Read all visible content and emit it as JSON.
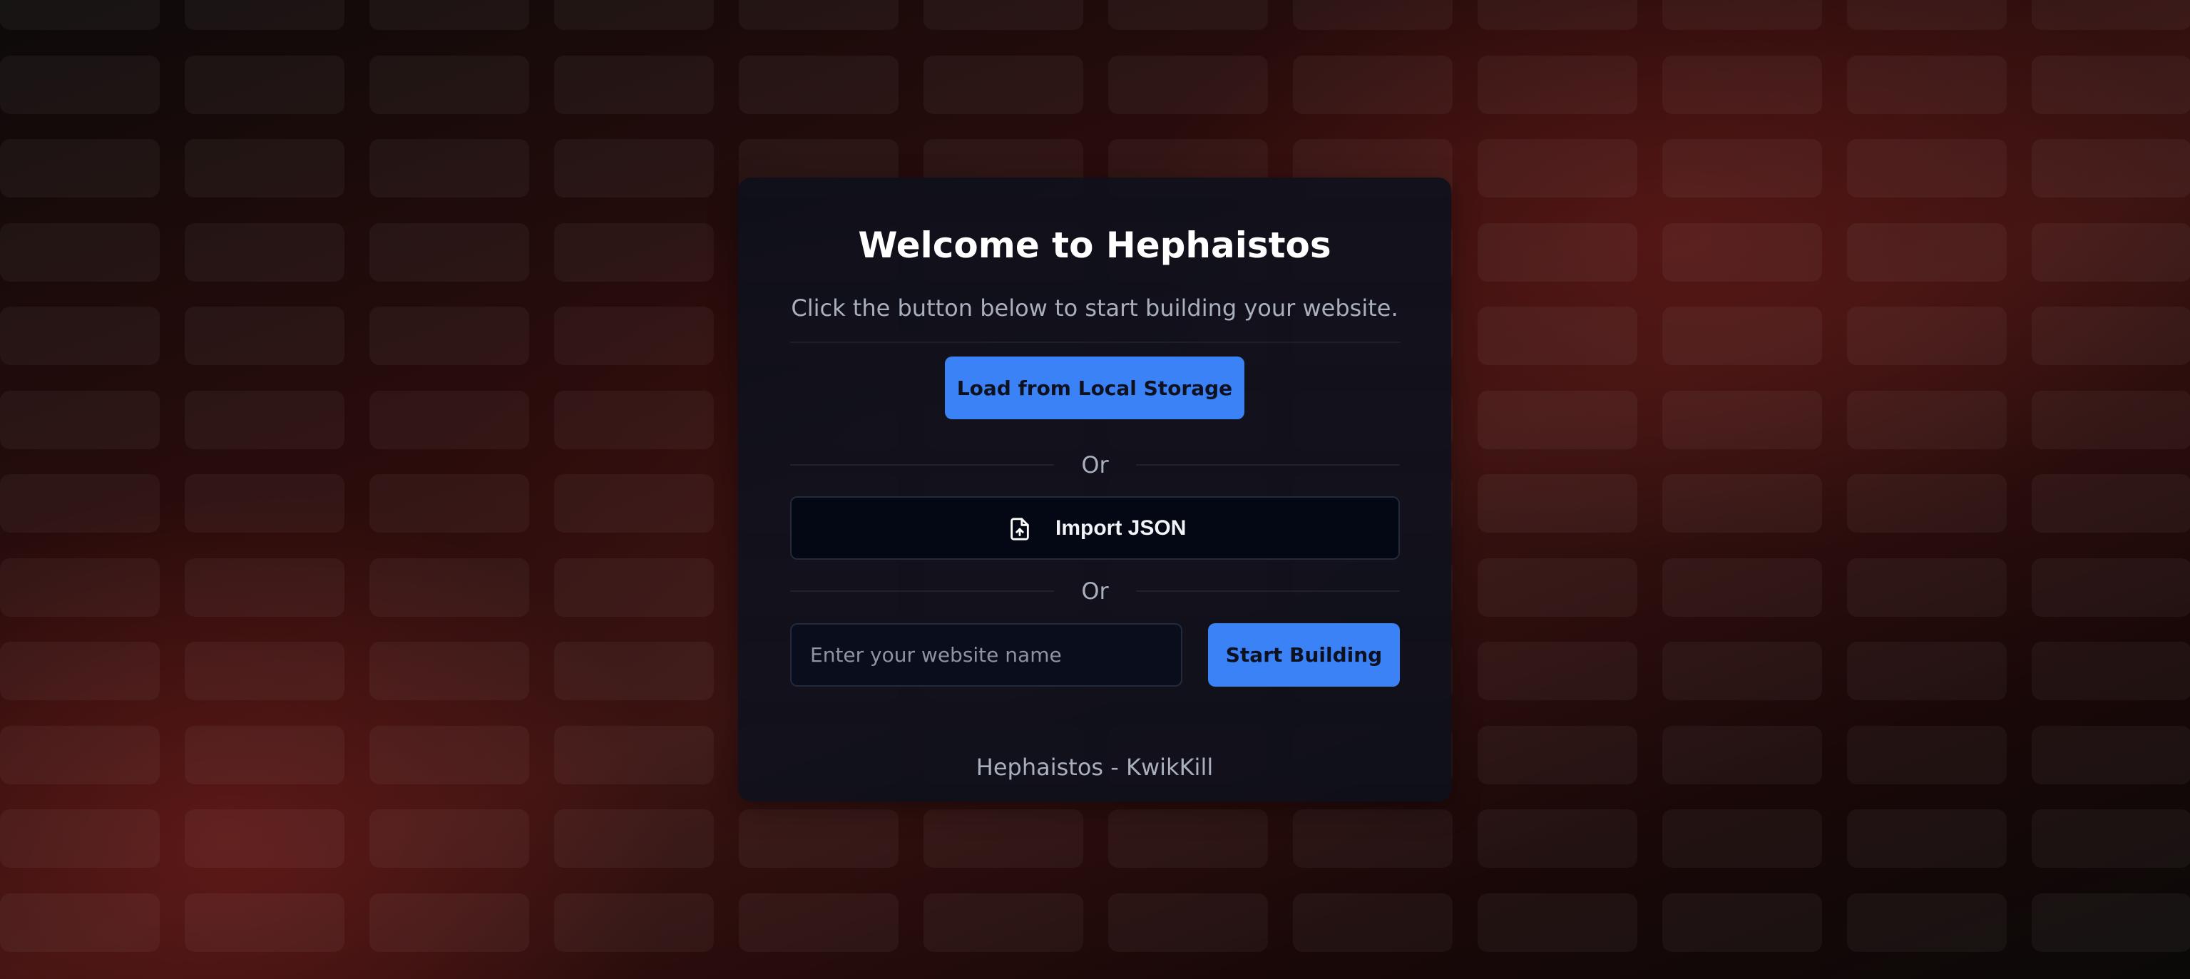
{
  "welcome": {
    "title": "Welcome to Hephaistos",
    "subtitle": "Click the button below to start building your website.",
    "load_button_label": "Load from Local Storage",
    "or_label_1": "Or",
    "import_button": {
      "icon": "file-upload-icon",
      "label": "Import JSON"
    },
    "or_label_2": "Or",
    "website_name_input": {
      "value": "",
      "placeholder": "Enter your website name"
    },
    "start_button_label": "Start Building",
    "footer": "Hephaistos - KwikKill"
  },
  "colors": {
    "accent": "#3b82f6",
    "card_background": "#0e101c",
    "background_tint": "#3a1311"
  }
}
